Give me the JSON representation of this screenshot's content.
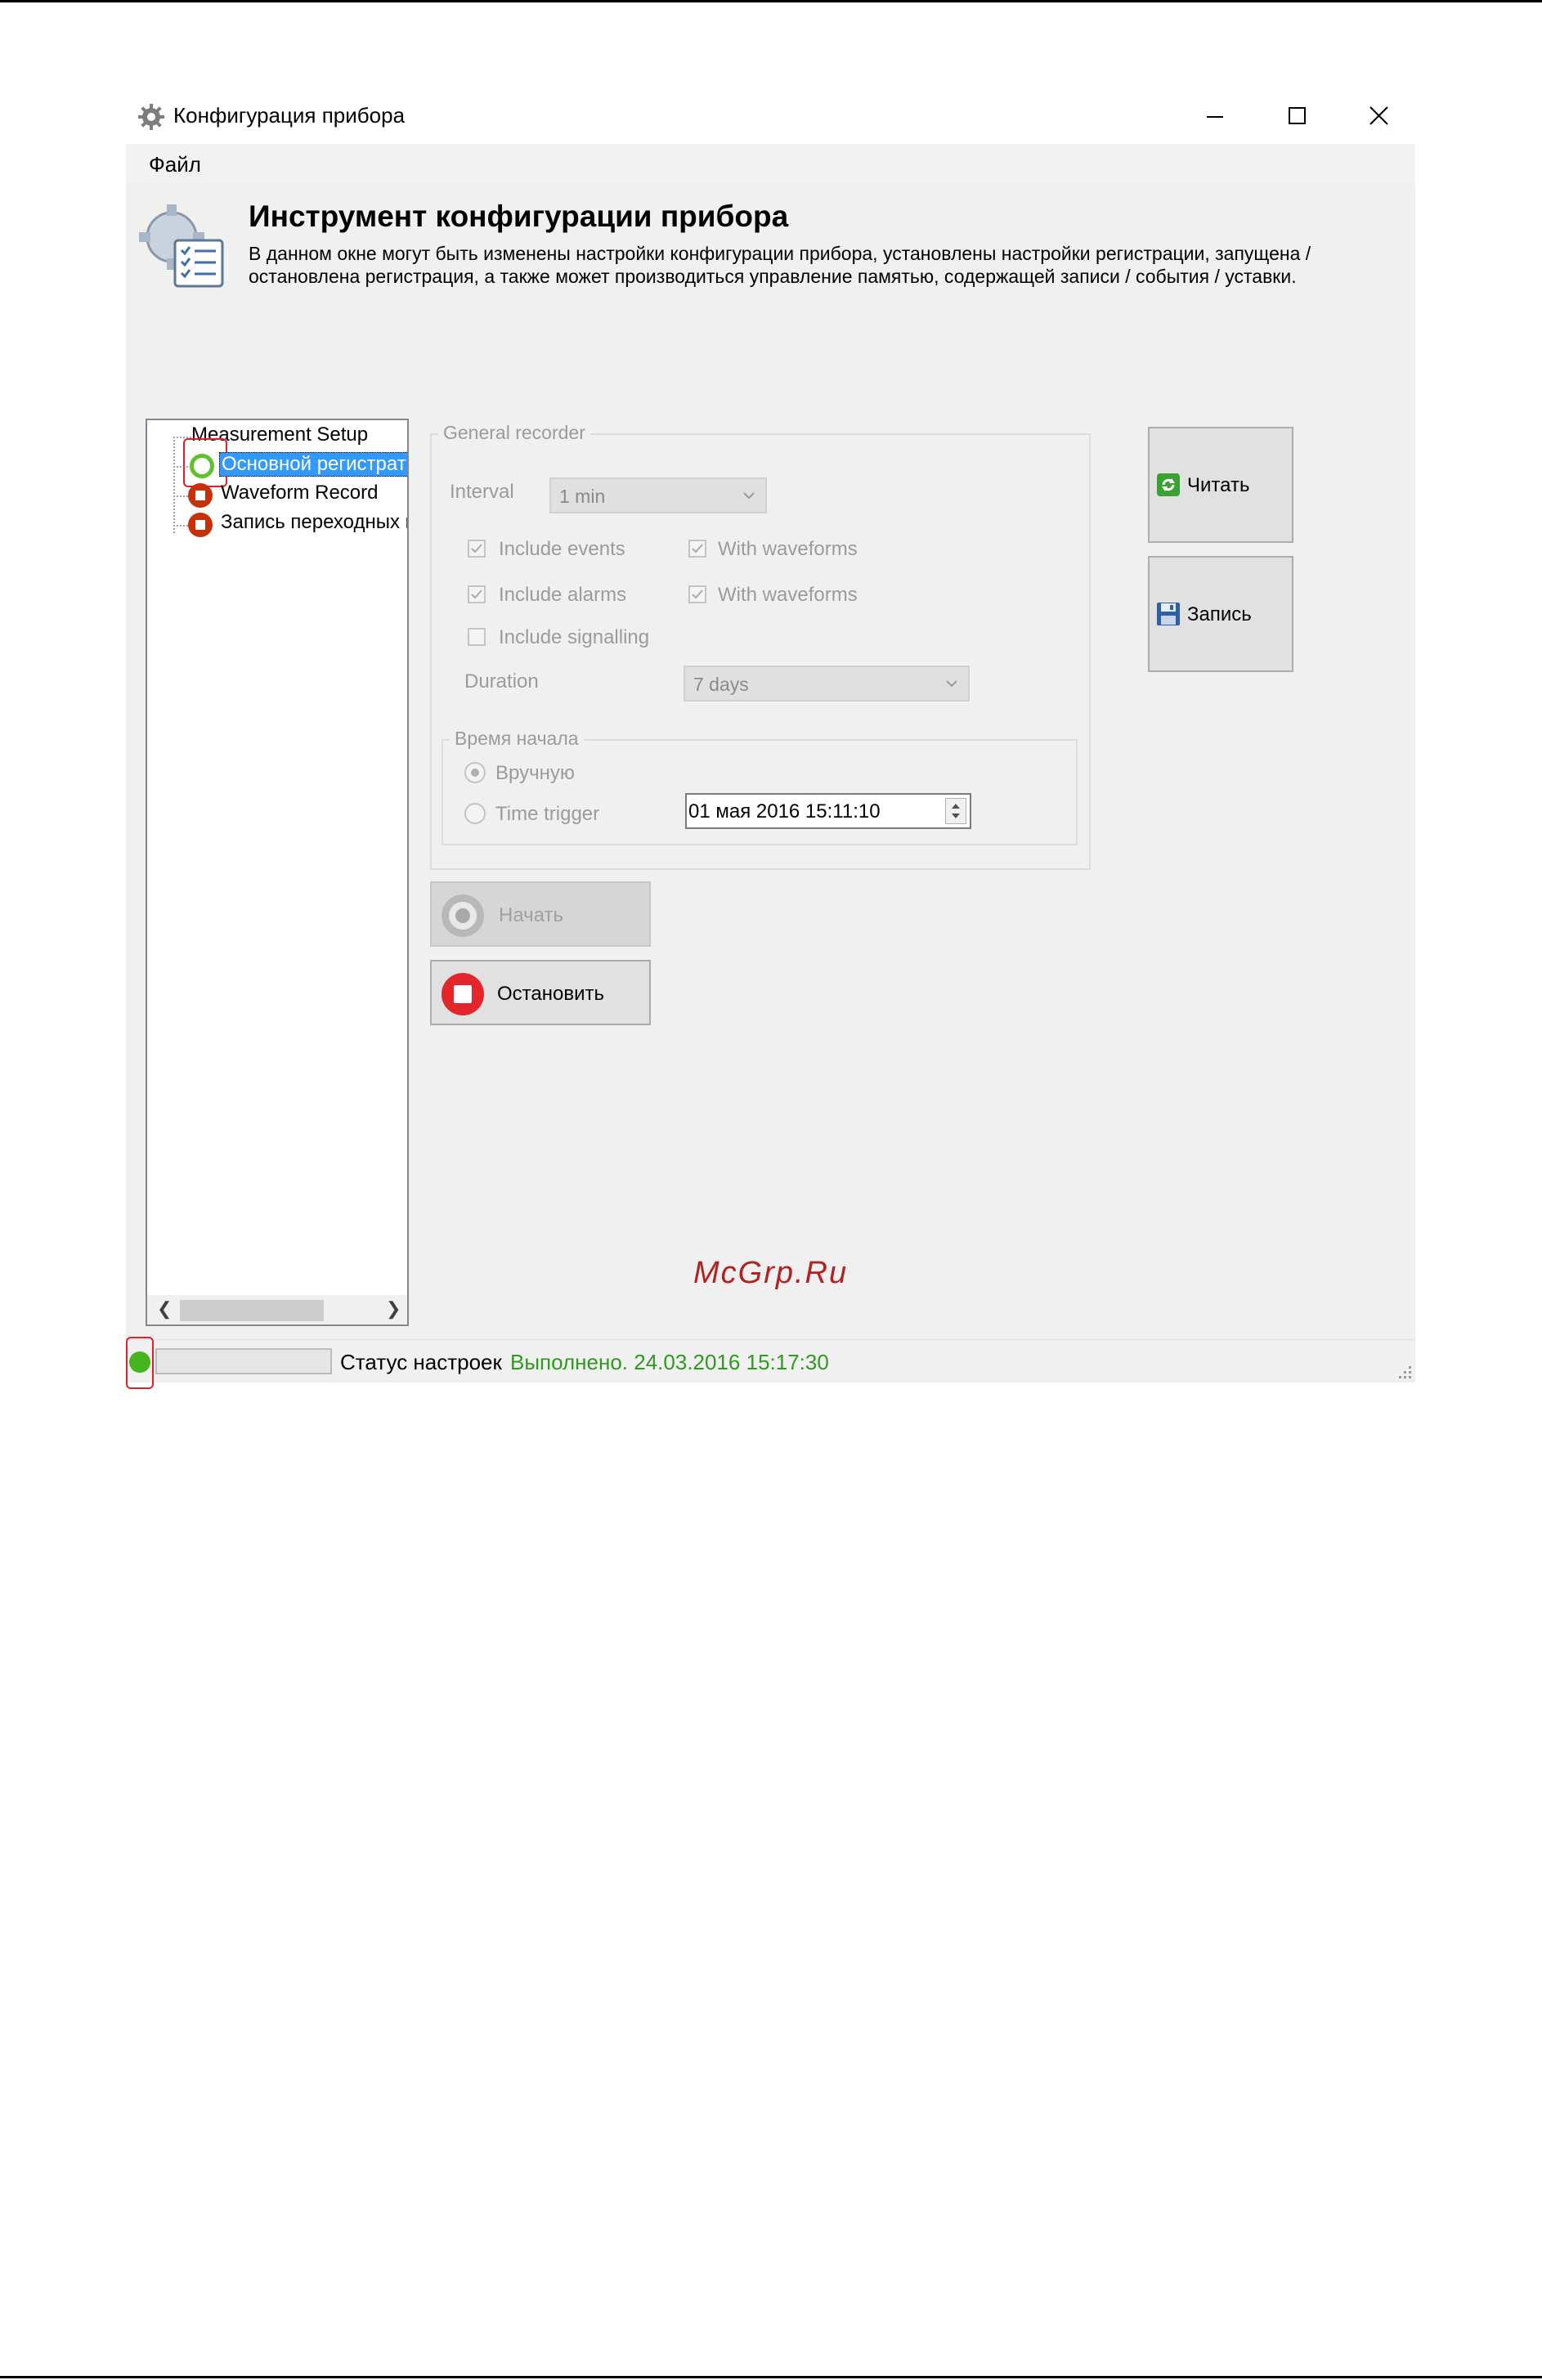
{
  "window": {
    "title": "Конфигурация прибора",
    "menu": [
      "Файл"
    ]
  },
  "header": {
    "title": "Инструмент конфигурации прибора",
    "description": "В данном окне могут быть изменены настройки конфигурации прибора, установлены настройки регистрации, запущена / остановлена регистрация, а также может производиться управление памятью, содержащей записи / события / уставки."
  },
  "tree": {
    "root": "Measurement Setup",
    "items": [
      {
        "label": "Основной регистрат",
        "state": "running",
        "selected": true
      },
      {
        "label": "Waveform Record",
        "state": "stopped",
        "selected": false
      },
      {
        "label": "Запись переходных п",
        "state": "stopped",
        "selected": false
      }
    ]
  },
  "recorder": {
    "group_title": "General recorder",
    "interval_label": "Interval",
    "interval_value": "1 min",
    "include_events": {
      "label": "Include events",
      "checked": true
    },
    "events_waveforms": {
      "label": "With waveforms",
      "checked": true
    },
    "include_alarms": {
      "label": "Include alarms",
      "checked": true
    },
    "alarms_waveforms": {
      "label": "With waveforms",
      "checked": true
    },
    "include_signalling": {
      "label": "Include signalling",
      "checked": false
    },
    "duration_label": "Duration",
    "duration_value": "7 days",
    "start_group_title": "Время начала",
    "manual_label": "Вручную",
    "time_trigger_label": "Time trigger",
    "datetime_value": "01 мая 2016 15:11:10"
  },
  "buttons": {
    "start": "Начать",
    "stop": "Остановить",
    "read": "Читать",
    "write": "Запись"
  },
  "status": {
    "label": "Статус настроек",
    "value": "Выполнено. 24.03.2016 15:17:30"
  },
  "watermark": "McGrp.Ru",
  "colors": {
    "running": "#5fc12b",
    "stopped": "#c7310a",
    "status_ok": "#2e9a1e",
    "selection": "#3399ff"
  }
}
